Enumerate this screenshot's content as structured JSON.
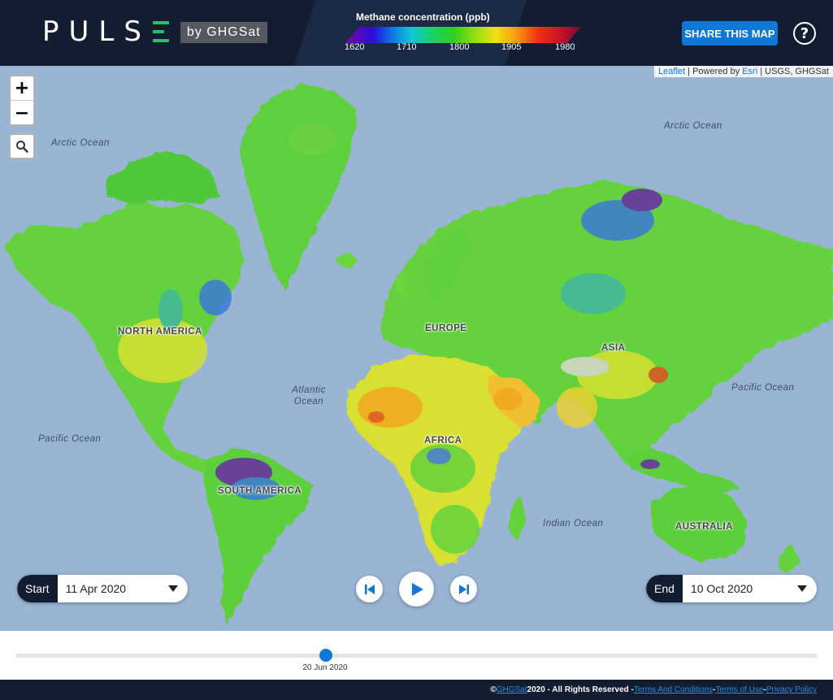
{
  "header": {
    "logo_word": "PULS",
    "logo_by": "by GHGSat",
    "share_label": "SHARE THIS MAP",
    "help_label": "?"
  },
  "legend": {
    "title": "Methane concentration (ppb)",
    "ticks": [
      "1620",
      "1710",
      "1800",
      "1905",
      "1980"
    ],
    "colors": [
      "#7a06a8",
      "#2a10d8",
      "#0a78e8",
      "#10c8d8",
      "#18d070",
      "#30d020",
      "#a0e010",
      "#f0e010",
      "#f8a010",
      "#f03010",
      "#c0102a",
      "#701030"
    ]
  },
  "map": {
    "attribution": {
      "leaflet": "Leaflet",
      "powered": " | Powered by ",
      "esri": "Esri",
      "rest": " | USGS, GHGSat"
    },
    "zoom_in": "+",
    "zoom_out": "−",
    "oceans": {
      "arctic_west": "Arctic Ocean",
      "arctic_east": "Arctic Ocean",
      "atlantic_1": "Atlantic",
      "atlantic_2": "Ocean",
      "pacific_west": "Pacific Ocean",
      "pacific_east": "Pacific Ocean",
      "indian": "Indian Ocean"
    },
    "continents": {
      "north_america": "NORTH AMERICA",
      "south_america": "SOUTH AMERICA",
      "europe": "EUROPE",
      "africa": "AFRICA",
      "asia": "ASIA",
      "australia": "AUSTRALIA"
    },
    "colors": {
      "ocean": "#9ab5d4",
      "land_base": "#64d23c",
      "land_dark": "#3fb83a",
      "land_yellow": "#d8e030",
      "land_orange": "#f0a820",
      "land_blue": "#3a7ad8",
      "land_purple": "#6a2aa8",
      "snow": "#d9d6cf"
    }
  },
  "controls": {
    "start_label": "Start",
    "start_value": "11 Apr 2020",
    "end_label": "End",
    "end_value": "10 Oct 2020"
  },
  "timeline": {
    "current_label": "20 Jun 2020",
    "position_fraction": 0.38
  },
  "footer": {
    "copyright_prefix": "© ",
    "company": "GHGSat",
    "copyright_suffix": " 2020 - All Rights Reserved - ",
    "terms_conditions": "Terms And Conditions",
    "sep1": " - ",
    "terms_use": "Terms of Use",
    "sep2": " - ",
    "privacy": "Privacy Policy"
  }
}
